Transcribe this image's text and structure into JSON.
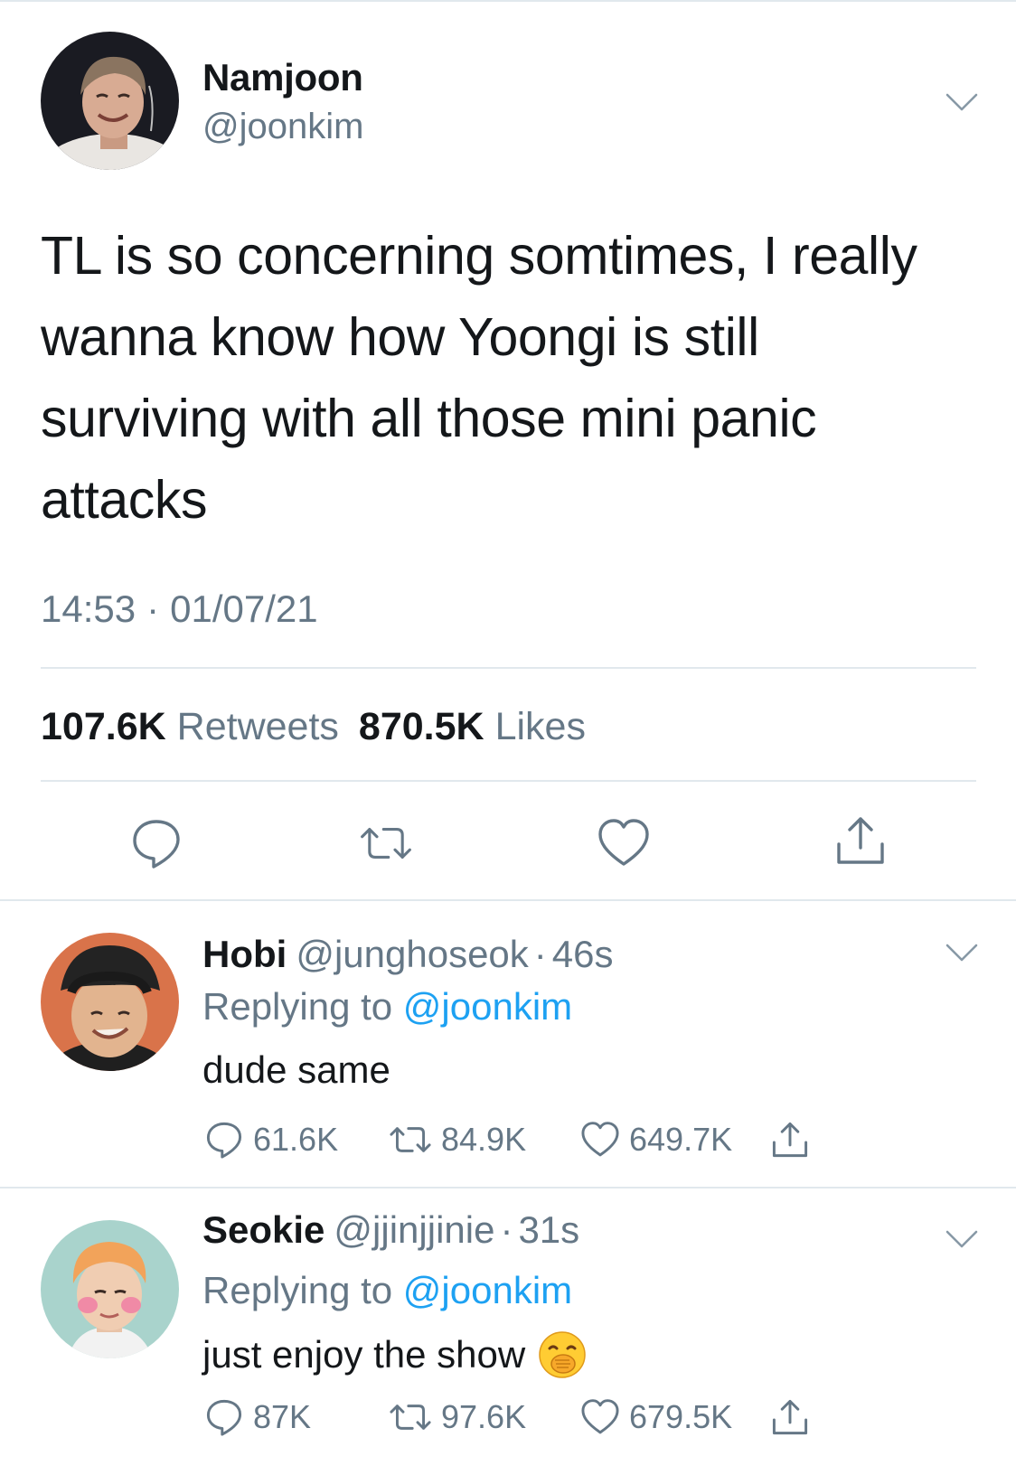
{
  "tweet": {
    "author_name": "Namjoon",
    "author_handle": "@joonkim",
    "text": "TL is so concerning somtimes, I really wanna know how Yoongi is still surviving with all those mini panic attacks",
    "time": "14:53",
    "separator": "·",
    "date": "01/07/21",
    "retweets_count": "107.6K",
    "retweets_label": "Retweets",
    "likes_count": "870.5K",
    "likes_label": "Likes"
  },
  "replies": [
    {
      "name": "Hobi",
      "handle": "@junghoseok",
      "dot": "·",
      "time": "46s",
      "replying_prefix": "Replying to",
      "replying_mention": "@joonkim",
      "text": "dude same",
      "replies_count": "61.6K",
      "retweets_count": "84.9K",
      "likes_count": "649.7K"
    },
    {
      "name": "Seokie",
      "handle": "@jjinjjinie",
      "dot": "·",
      "time": "31s",
      "replying_prefix": "Replying to",
      "replying_mention": "@joonkim",
      "text": "just enjoy the show",
      "emoji": "face-with-hand-over-mouth",
      "replies_count": "87K",
      "retweets_count": "97.6K",
      "likes_count": "679.5K"
    }
  ],
  "colors": {
    "text": "#14171a",
    "secondary": "#657786",
    "link": "#1da1f2",
    "divider": "#e1e8ed",
    "icon": "#657786"
  },
  "icons": [
    "chevron-down-icon",
    "reply-icon",
    "retweet-icon",
    "like-icon",
    "share-icon"
  ]
}
